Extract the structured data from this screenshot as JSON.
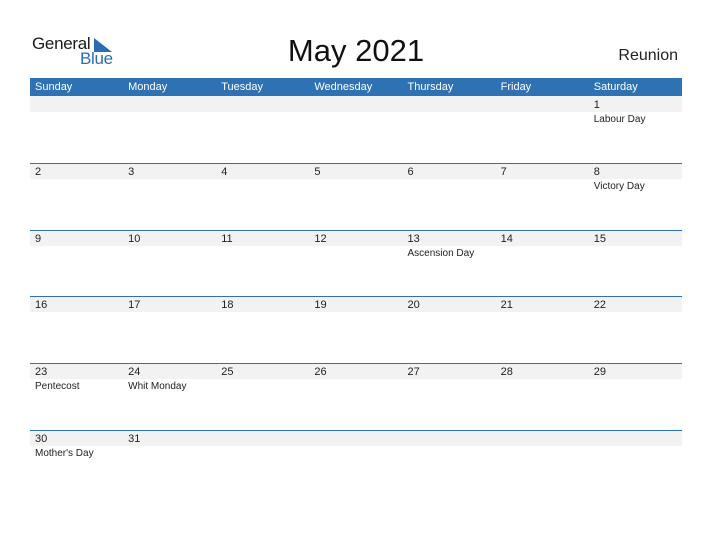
{
  "logo": {
    "word1": "General",
    "word2": "Blue"
  },
  "title": "May 2021",
  "region": "Reunion",
  "colors": {
    "accent": "#2f72b3",
    "strip": "#f2f2f2"
  },
  "weekdays": [
    "Sunday",
    "Monday",
    "Tuesday",
    "Wednesday",
    "Thursday",
    "Friday",
    "Saturday"
  ],
  "weeks": [
    [
      {
        "d": "",
        "h": ""
      },
      {
        "d": "",
        "h": ""
      },
      {
        "d": "",
        "h": ""
      },
      {
        "d": "",
        "h": ""
      },
      {
        "d": "",
        "h": ""
      },
      {
        "d": "",
        "h": ""
      },
      {
        "d": "1",
        "h": "Labour Day"
      }
    ],
    [
      {
        "d": "2",
        "h": ""
      },
      {
        "d": "3",
        "h": ""
      },
      {
        "d": "4",
        "h": ""
      },
      {
        "d": "5",
        "h": ""
      },
      {
        "d": "6",
        "h": ""
      },
      {
        "d": "7",
        "h": ""
      },
      {
        "d": "8",
        "h": "Victory Day"
      }
    ],
    [
      {
        "d": "9",
        "h": ""
      },
      {
        "d": "10",
        "h": ""
      },
      {
        "d": "11",
        "h": ""
      },
      {
        "d": "12",
        "h": ""
      },
      {
        "d": "13",
        "h": "Ascension Day"
      },
      {
        "d": "14",
        "h": ""
      },
      {
        "d": "15",
        "h": ""
      }
    ],
    [
      {
        "d": "16",
        "h": ""
      },
      {
        "d": "17",
        "h": ""
      },
      {
        "d": "18",
        "h": ""
      },
      {
        "d": "19",
        "h": ""
      },
      {
        "d": "20",
        "h": ""
      },
      {
        "d": "21",
        "h": ""
      },
      {
        "d": "22",
        "h": ""
      }
    ],
    [
      {
        "d": "23",
        "h": "Pentecost"
      },
      {
        "d": "24",
        "h": "Whit Monday"
      },
      {
        "d": "25",
        "h": ""
      },
      {
        "d": "26",
        "h": ""
      },
      {
        "d": "27",
        "h": ""
      },
      {
        "d": "28",
        "h": ""
      },
      {
        "d": "29",
        "h": ""
      }
    ],
    [
      {
        "d": "30",
        "h": "Mother's Day"
      },
      {
        "d": "31",
        "h": ""
      },
      {
        "d": "",
        "h": ""
      },
      {
        "d": "",
        "h": ""
      },
      {
        "d": "",
        "h": ""
      },
      {
        "d": "",
        "h": ""
      },
      {
        "d": "",
        "h": ""
      }
    ]
  ]
}
